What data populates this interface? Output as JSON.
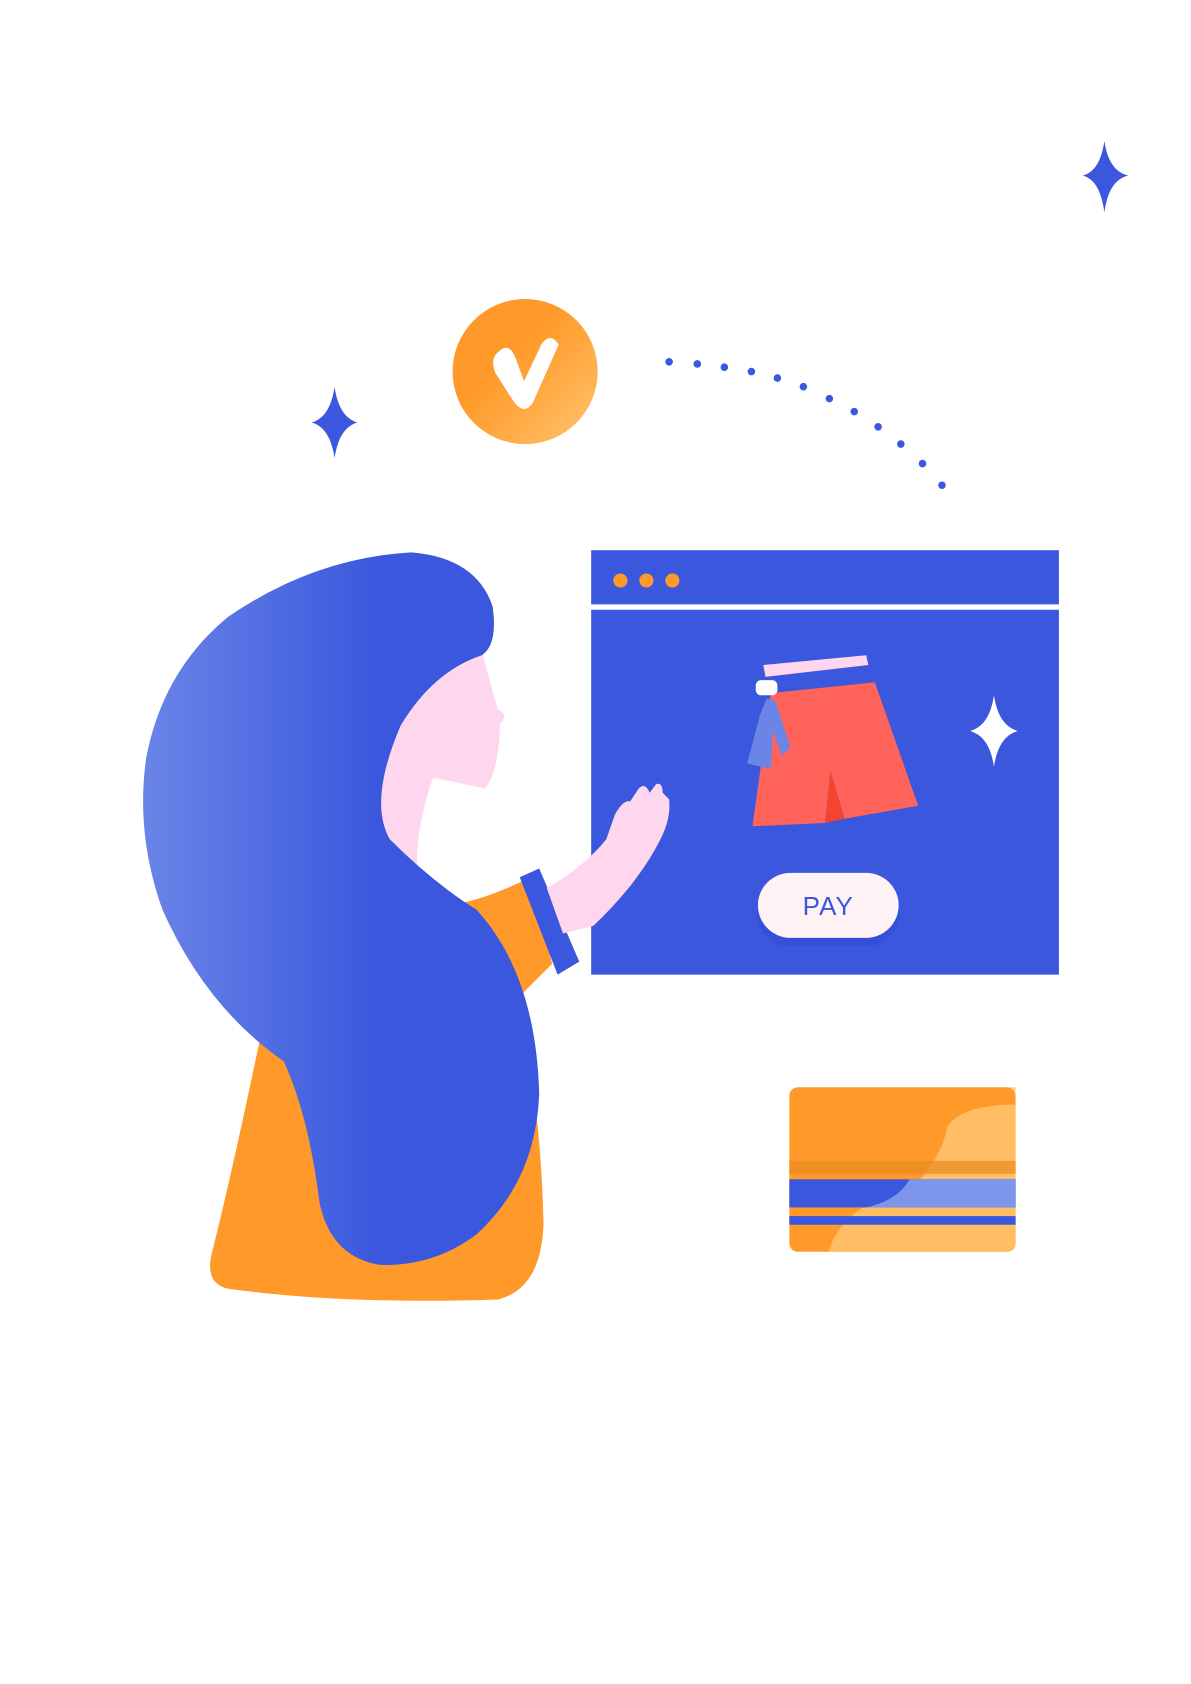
{
  "illustration": {
    "pay_button_label": "PAY",
    "icons": [
      "sparkle-icon",
      "checkmark-badge-icon",
      "shorts-icon",
      "credit-card-icon",
      "window-dots-icon"
    ],
    "colors": {
      "primary_blue": "#3A57DE",
      "light_blue": "#6A85E6",
      "orange": "#FF9A2A",
      "light_orange": "#FFC46E",
      "shorts_red": "#FF635A",
      "skin_pink": "#FED7EE",
      "button_bg": "#FFF2F4"
    }
  }
}
